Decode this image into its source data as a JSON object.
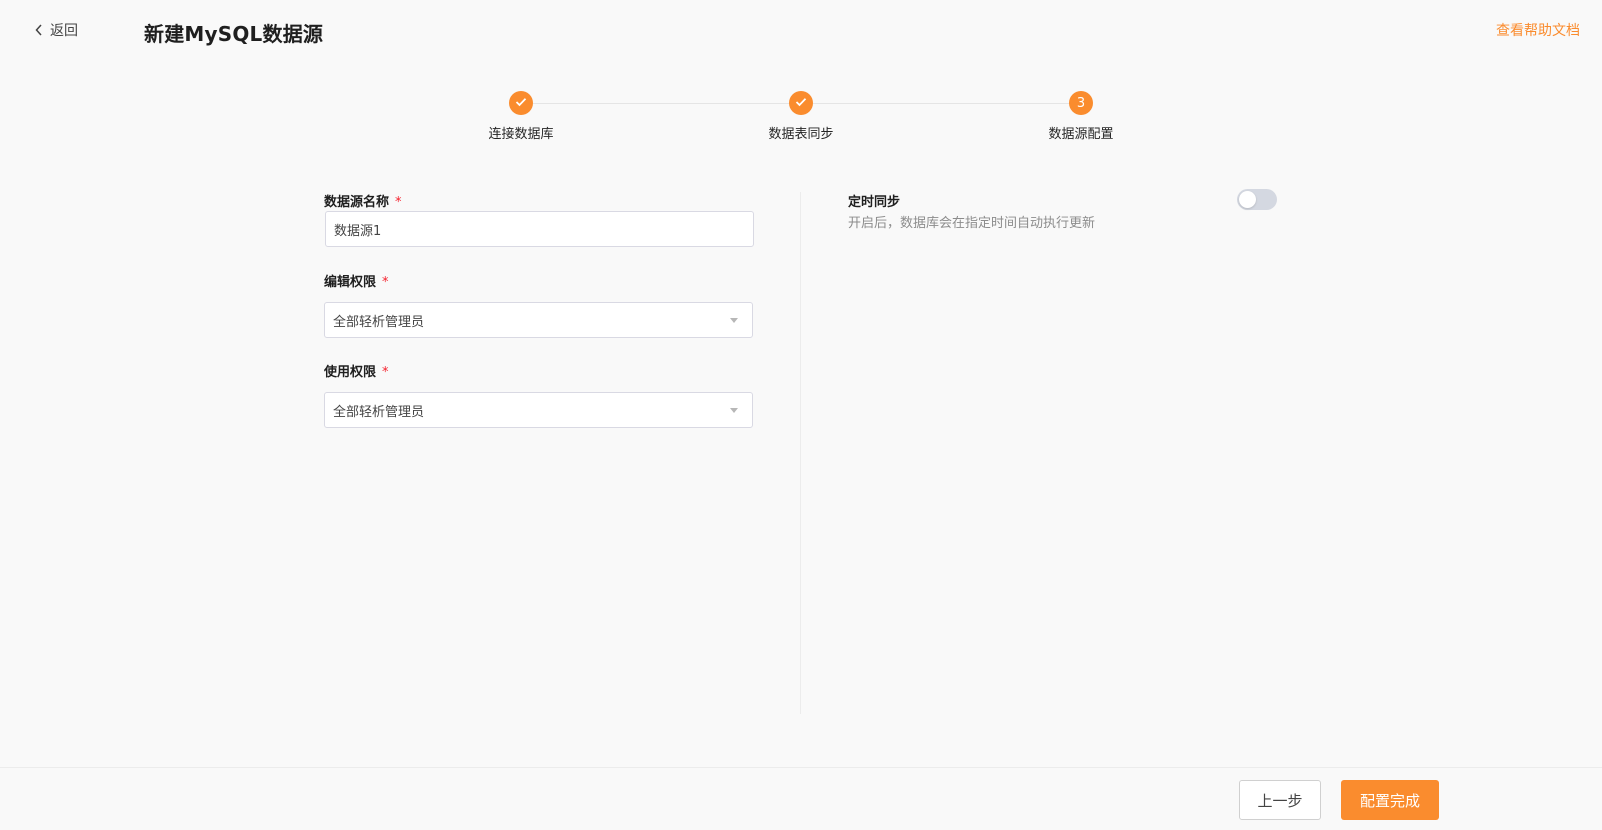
{
  "header": {
    "back_label": "返回",
    "title": "新建MySQL数据源",
    "help_label": "查看帮助文档"
  },
  "steps": [
    {
      "label": "连接数据库",
      "status": "done",
      "icon": "check-icon"
    },
    {
      "label": "数据表同步",
      "status": "done",
      "icon": "check-icon"
    },
    {
      "label": "数据源配置",
      "status": "current",
      "number": "3"
    }
  ],
  "form": {
    "name": {
      "label": "数据源名称",
      "required_mark": "*",
      "value": "数据源1"
    },
    "edit_permission": {
      "label": "编辑权限",
      "required_mark": "*",
      "value": "全部轻析管理员"
    },
    "use_permission": {
      "label": "使用权限",
      "required_mark": "*",
      "value": "全部轻析管理员"
    }
  },
  "schedule": {
    "title": "定时同步",
    "description": "开启后，数据库会在指定时间自动执行更新",
    "enabled": false
  },
  "footer": {
    "prev_label": "上一步",
    "done_label": "配置完成"
  },
  "colors": {
    "accent": "#fa8c2e",
    "required": "#f5222d",
    "toggle_off": "#d4d8e1"
  }
}
